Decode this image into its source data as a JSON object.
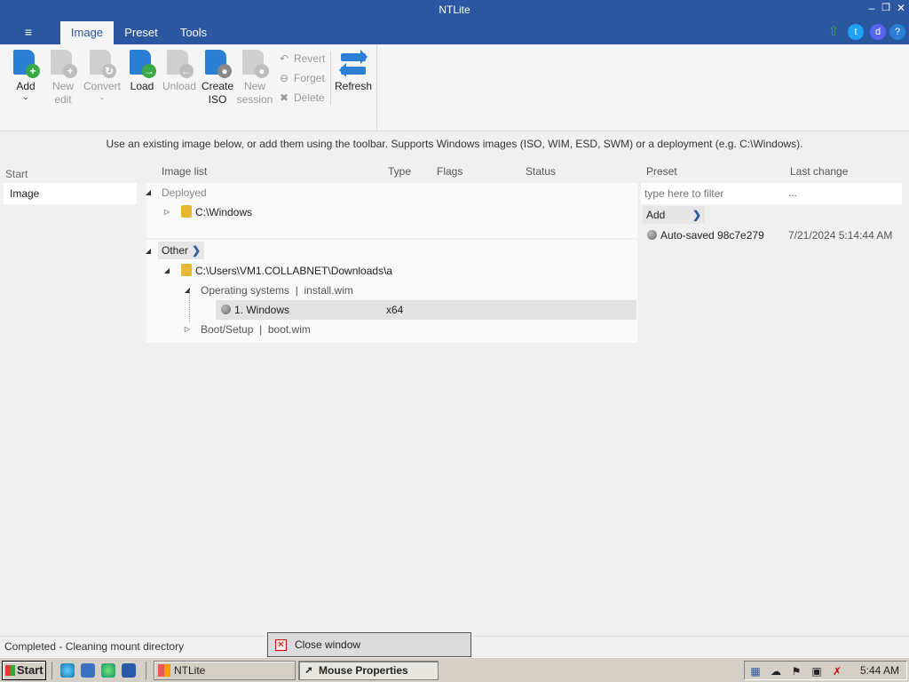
{
  "window": {
    "title": "NTLite"
  },
  "tabs": [
    {
      "label": "Image",
      "active": true
    },
    {
      "label": "Preset",
      "active": false
    },
    {
      "label": "Tools",
      "active": false
    }
  ],
  "ribbon": {
    "add": "Add",
    "new_edit_1": "New",
    "new_edit_2": "edit",
    "convert": "Convert",
    "load": "Load",
    "unload": "Unload",
    "create_iso_1": "Create",
    "create_iso_2": "ISO",
    "new_session_1": "New",
    "new_session_2": "session",
    "revert": "Revert",
    "forget": "Forget",
    "delete": "Delete",
    "refresh": "Refresh"
  },
  "hint": "Use an existing image below, or add them using the toolbar. Supports Windows images (ISO, WIM, ESD, SWM) or a deployment (e.g. C:\\Windows).",
  "leftnav": {
    "header": "Start",
    "item": "Image"
  },
  "image_list": {
    "columns": [
      "Image list",
      "Type",
      "Flags",
      "Status"
    ],
    "deployed_label": "Deployed",
    "deployed_path": "C:\\Windows",
    "other_label": "Other",
    "other_path": "C:\\Users\\VM1.COLLABNET\\Downloads\\a",
    "os_group": "Operating systems",
    "os_file": "install.wim",
    "windows_item": "1. Windows",
    "windows_type": "x64",
    "boot_group": "Boot/Setup",
    "boot_file": "boot.wim",
    "sep": "|"
  },
  "presets": {
    "columns": [
      "Preset",
      "Last change"
    ],
    "filter_placeholder": "type here to filter",
    "filter_more": "...",
    "add_label": "Add",
    "items": [
      {
        "name": "Auto-saved 98c7e279",
        "date": "7/21/2024 5:14:44 AM"
      }
    ]
  },
  "status": {
    "text": "Completed - Cleaning mount directory"
  },
  "close_window_label": "Close window",
  "taskbar": {
    "start": "Start",
    "tasks": [
      {
        "label": "NTLite",
        "active": false
      },
      {
        "label": "Mouse Properties",
        "active": true
      }
    ],
    "clock": "5:44 AM"
  },
  "colors": {
    "titlebar": "#2b57a0",
    "accent_green": "#3aa845",
    "accent_blue": "#2b7fd4"
  }
}
